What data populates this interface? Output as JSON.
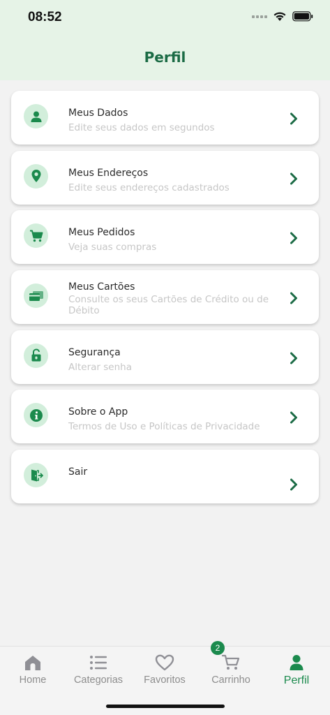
{
  "status_bar": {
    "time": "08:52"
  },
  "header": {
    "title": "Perfil"
  },
  "menu": [
    {
      "title": "Meus Dados",
      "subtitle": "Edite seus dados em segundos",
      "icon": "user-icon"
    },
    {
      "title": "Meus Endereços",
      "subtitle": "Edite seus endereços cadastrados",
      "icon": "location-pin-icon"
    },
    {
      "title": "Meus Pedidos",
      "subtitle": "Veja suas compras",
      "icon": "cart-icon"
    },
    {
      "title": "Meus Cartões",
      "subtitle": "Consulte os seus Cartões de Crédito ou de Débito",
      "icon": "credit-card-icon"
    },
    {
      "title": "Segurança",
      "subtitle": "Alterar senha",
      "icon": "unlock-icon"
    },
    {
      "title": "Sobre o App",
      "subtitle": "Termos de Uso e Políticas de Privacidade",
      "icon": "info-icon"
    },
    {
      "title": "Sair",
      "subtitle": "",
      "icon": "logout-door-icon"
    }
  ],
  "tabbar": {
    "tabs": [
      {
        "label": "Home",
        "icon": "home-icon"
      },
      {
        "label": "Categorias",
        "icon": "list-icon"
      },
      {
        "label": "Favoritos",
        "icon": "heart-icon"
      },
      {
        "label": "Carrinho",
        "icon": "cart-icon"
      },
      {
        "label": "Perfil",
        "icon": "user-icon"
      }
    ],
    "active_tab": "Perfil",
    "cart_badge": "2"
  },
  "colors": {
    "accent": "#1b8a4d",
    "title_green": "#1b6b45",
    "header_bg": "#e6f3e7",
    "icon_circle_bg": "#d2eedb",
    "subtitle_text": "#c6c6c6"
  }
}
